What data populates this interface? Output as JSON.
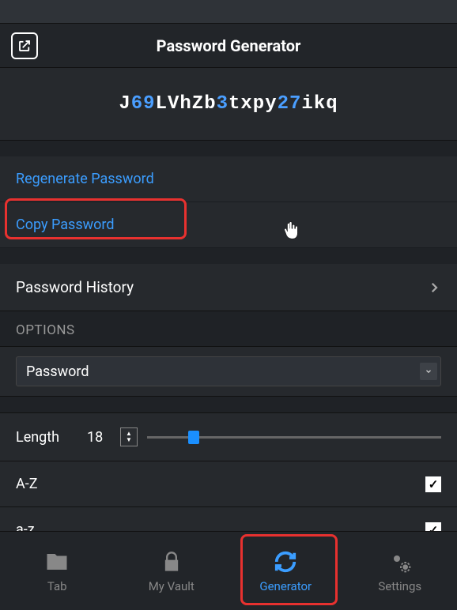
{
  "header": {
    "title": "Password Generator"
  },
  "password": {
    "segments": [
      {
        "t": "let",
        "v": "J"
      },
      {
        "t": "num",
        "v": "69"
      },
      {
        "t": "let",
        "v": "LVhZb"
      },
      {
        "t": "num",
        "v": "3"
      },
      {
        "t": "let",
        "v": "txpy"
      },
      {
        "t": "num",
        "v": "27"
      },
      {
        "t": "let",
        "v": "ikq"
      }
    ]
  },
  "actions": {
    "regenerate": "Regenerate Password",
    "copy": "Copy Password",
    "history": "Password History"
  },
  "options": {
    "section_label": "OPTIONS",
    "type_selected": "Password",
    "length_label": "Length",
    "length_value": "18",
    "upper_label": "A-Z",
    "lower_label": "a-z",
    "upper_checked": true,
    "lower_checked": true
  },
  "nav": {
    "tab": "Tab",
    "vault": "My Vault",
    "generator": "Generator",
    "settings": "Settings",
    "active": "generator"
  }
}
